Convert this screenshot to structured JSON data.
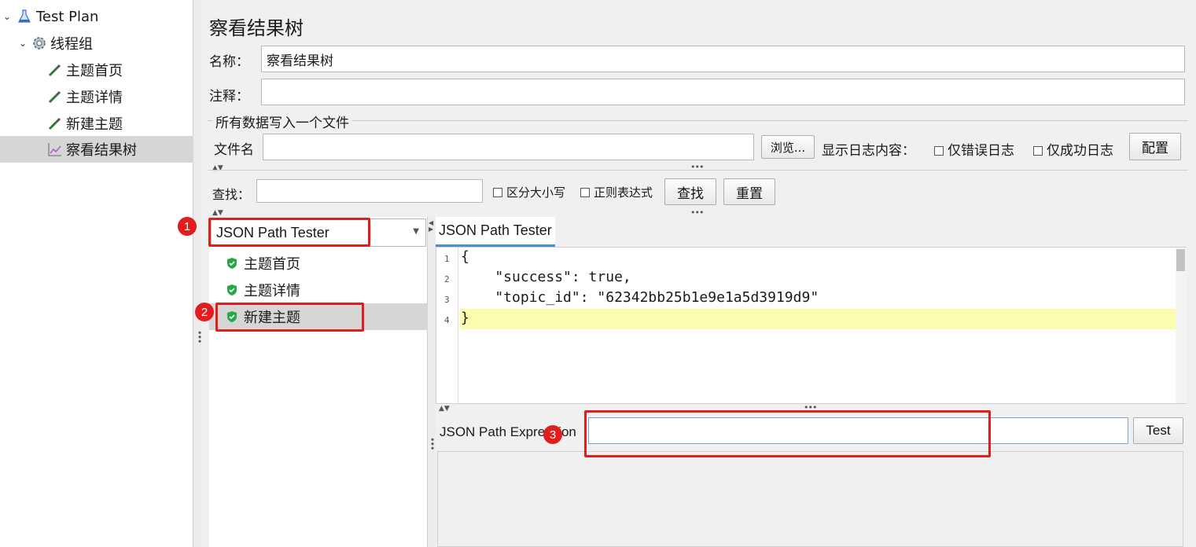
{
  "tree": {
    "items": [
      {
        "label": "Test Plan",
        "icon": "flask-icon"
      },
      {
        "label": "线程组",
        "icon": "gear-icon"
      },
      {
        "label": "主题首页",
        "icon": "pipette-icon"
      },
      {
        "label": "主题详情",
        "icon": "pipette-icon"
      },
      {
        "label": "新建主题",
        "icon": "pipette-icon"
      },
      {
        "label": "察看结果树",
        "icon": "chart-icon"
      }
    ]
  },
  "panel": {
    "title": "察看结果树",
    "name_label": "名称：",
    "name_value": "察看结果树",
    "comment_label": "注释：",
    "comment_value": "",
    "file_section_title": "所有数据写入一个文件",
    "filename_label": "文件名",
    "filename_value": "",
    "browse_button": "浏览...",
    "log_content_label": "显示日志内容：",
    "errors_only_label": "仅错误日志",
    "success_only_label": "仅成功日志",
    "configure_button": "配置"
  },
  "search": {
    "label": "查找：",
    "value": "",
    "case_sensitive_label": "区分大小写",
    "regex_label": "正则表达式",
    "find_button": "查找",
    "reset_button": "重置"
  },
  "renderer": {
    "selected": "JSON Path Tester"
  },
  "results": {
    "items": [
      "主题首页",
      "主题详情",
      "新建主题"
    ]
  },
  "tester": {
    "tab_label": "JSON Path Tester",
    "line_numbers": [
      "1",
      "2",
      "3",
      "4"
    ],
    "code_lines": [
      "{",
      "    \"success\": true,",
      "    \"topic_id\": \"62342bb25b1e9e1a5d3919d9\"",
      "}"
    ],
    "expression_label": "JSON Path Expression",
    "expression_value": "",
    "test_button": "Test"
  },
  "annotations": {
    "badges": [
      "1",
      "2",
      "3"
    ],
    "color": "#e11d1d"
  }
}
